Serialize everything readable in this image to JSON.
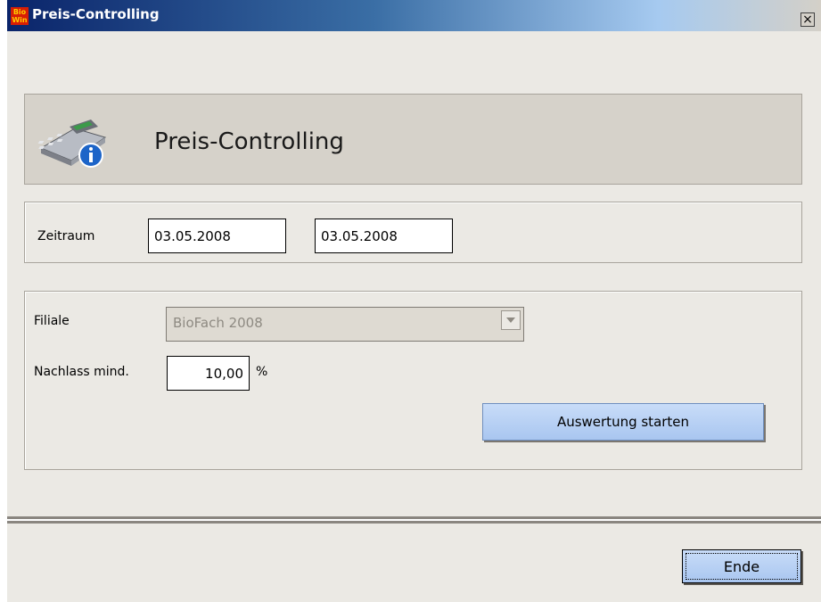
{
  "window": {
    "title": "Preis-Controlling",
    "logo_top": "Bio",
    "logo_bottom": "Win",
    "close_glyph": "×"
  },
  "header": {
    "icon": "cash-register-info-icon",
    "title": "Preis-Controlling"
  },
  "period": {
    "label": "Zeitraum",
    "from": "03.05.2008",
    "to": "03.05.2008"
  },
  "filter": {
    "branch_label": "Filiale",
    "branch_value": "BioFach 2008",
    "discount_label": "Nachlass mind.",
    "discount_value": "10,00",
    "discount_unit": "%",
    "start_button": "Auswertung starten"
  },
  "footer": {
    "end_button": "Ende"
  },
  "colors": {
    "titlebar_dark": "#0a246a",
    "window_bg": "#ebe9e4",
    "button_blue": "#b4cff4"
  }
}
